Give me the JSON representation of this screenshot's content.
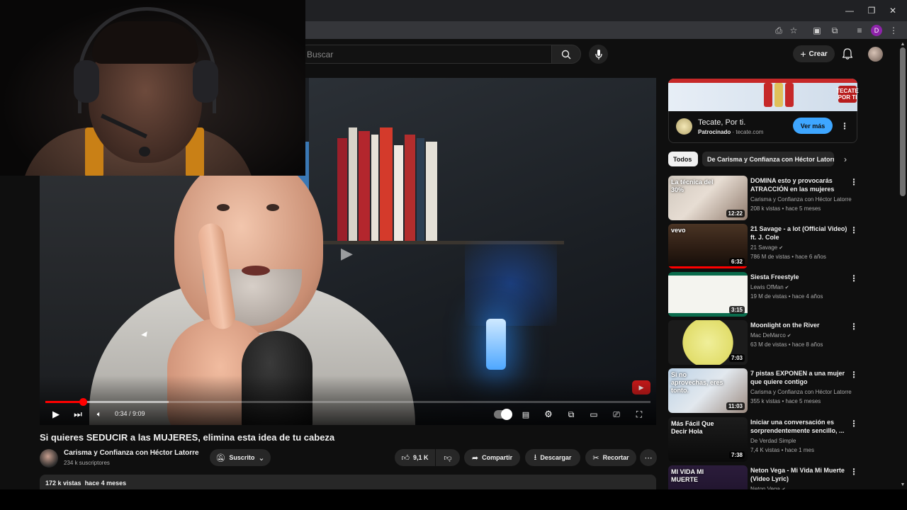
{
  "header": {
    "search_placeholder": "Buscar",
    "create_label": "Crear",
    "profile_initial": "D"
  },
  "player": {
    "time": "0:34 / 9:09",
    "progress_fraction": 0.062,
    "buffered_fraction": 0.204
  },
  "video": {
    "title": "Si quieres SEDUCIR a las MUJERES, elimina esta idea de tu cabeza",
    "channel_name": "Carisma y Confianza con Héctor Latorre",
    "subscribers": "234 k suscriptores",
    "subscribed_label": "Suscrito",
    "likes": "9,1 K",
    "share_label": "Compartir",
    "download_label": "Descargar",
    "clip_label": "Recortar",
    "views": "172 k vistas",
    "published": "hace 4 meses"
  },
  "ad": {
    "title": "Tecate, Por ti.",
    "sponsored": "Patrocinado",
    "domain": "tecate.com",
    "cta": "Ver más",
    "brand_text": "TECATE POR TI"
  },
  "chips": [
    {
      "label": "Todos",
      "active": true
    },
    {
      "label": "De Carisma y Confianza con Héctor Latorre",
      "active": false
    }
  ],
  "recommendations": [
    {
      "title": "DOMINA esto y provocarás ATRACCIÓN en las mujeres",
      "channel": "Carisma y Confianza con Héctor Latorre",
      "verified": false,
      "meta": "208 k vistas • hace 5 meses",
      "duration": "12:22",
      "thumb_text": "La técnica del 30%",
      "watched": 0
    },
    {
      "title": "21 Savage - a lot (Official Video) ft. J. Cole",
      "channel": "21 Savage",
      "verified": true,
      "meta": "786 M de vistas • hace 6 años",
      "duration": "6:32",
      "thumb_text": "vevo",
      "watched": 1
    },
    {
      "title": "Siesta Freestyle",
      "channel": "Lewis OfMan",
      "verified": true,
      "meta": "19 M de vistas • hace 4 años",
      "duration": "3:15",
      "thumb_text": "",
      "watched": 0
    },
    {
      "title": "Moonlight on the River",
      "channel": "Mac DeMarco",
      "verified": true,
      "meta": "63 M de vistas • hace 8 años",
      "duration": "7:03",
      "thumb_text": "",
      "watched": 0
    },
    {
      "title": "7 pistas EXPONEN a una mujer que quiere contigo",
      "channel": "Carisma y Confianza con Héctor Latorre",
      "verified": false,
      "meta": "355 k vistas • hace 5 meses",
      "duration": "11:03",
      "thumb_text": "Si no aprovechas, eres tonto.",
      "watched": 0
    },
    {
      "title": "Iniciar una conversación es sorprendentemente sencillo, ...",
      "channel": "De Verdad Simple",
      "verified": false,
      "meta": "7,4 K vistas • hace 1 mes",
      "duration": "7:38",
      "thumb_text": "Más Fácil Que Decir Hola",
      "watched": 0
    },
    {
      "title": "Neton Vega - Mi Vida Mi Muerte (Video Lyric)",
      "channel": "Neton Vega",
      "verified": true,
      "meta": "",
      "duration": "",
      "thumb_text": "MI VIDA MI MUERTE",
      "watched": 0
    }
  ],
  "colors": {
    "accent_red": "#ff0000",
    "cta_blue": "#3ea6ff",
    "background": "#0f0f0f",
    "surface": "#272727"
  }
}
